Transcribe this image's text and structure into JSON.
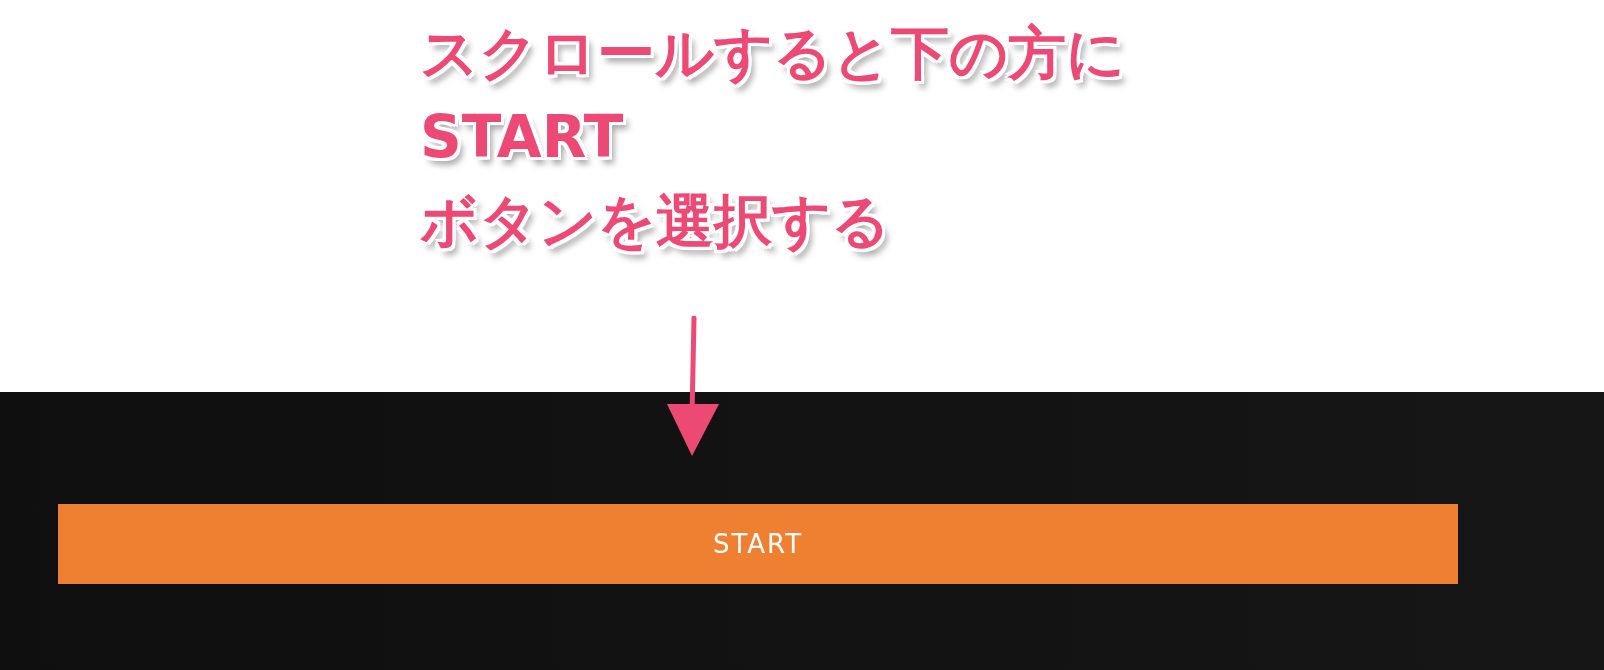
{
  "annotation": {
    "lines": [
      "スクロールすると下の方に",
      "START",
      "ボタンを選択する"
    ]
  },
  "start_button": {
    "label": "START"
  }
}
